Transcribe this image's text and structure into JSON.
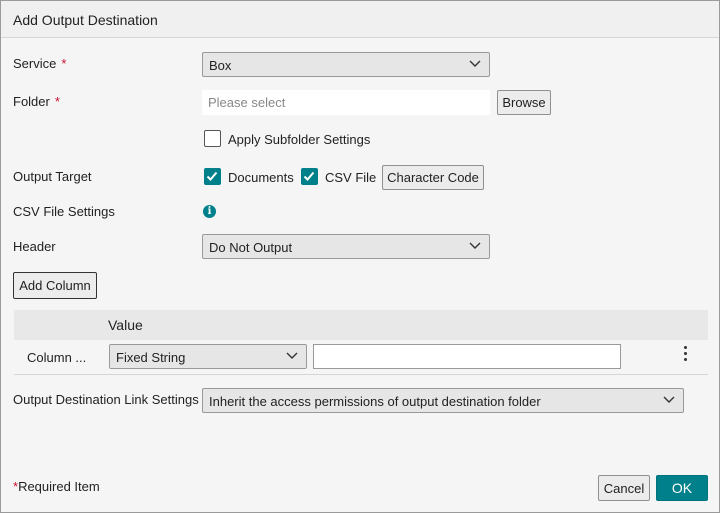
{
  "dialog": {
    "title": "Add Output Destination"
  },
  "service": {
    "label": "Service",
    "required_mark": "*",
    "value": "Box"
  },
  "folder": {
    "label": "Folder",
    "required_mark": "*",
    "placeholder": "Please select",
    "browse_label": "Browse"
  },
  "subfolder": {
    "label": "Apply Subfolder Settings",
    "checked": false
  },
  "output_target": {
    "label": "Output Target",
    "documents_label": "Documents",
    "documents_checked": true,
    "csv_label": "CSV File",
    "csv_checked": true,
    "character_code_label": "Character Code"
  },
  "csv_settings": {
    "label": "CSV File Settings",
    "info_icon": "info-icon"
  },
  "header": {
    "label": "Header",
    "value": "Do Not Output"
  },
  "columns": {
    "add_label": "Add Column",
    "value_header": "Value",
    "rows": [
      {
        "name": "Column ...",
        "type": "Fixed String",
        "value": ""
      }
    ]
  },
  "link_settings": {
    "label": "Output Destination Link Settings",
    "value": "Inherit the access permissions of output destination folder"
  },
  "footer": {
    "required_note_mark": "*",
    "required_note": "Required Item",
    "cancel_label": "Cancel",
    "ok_label": "OK"
  },
  "colors": {
    "accent": "#00808a",
    "required": "#c8102e"
  }
}
